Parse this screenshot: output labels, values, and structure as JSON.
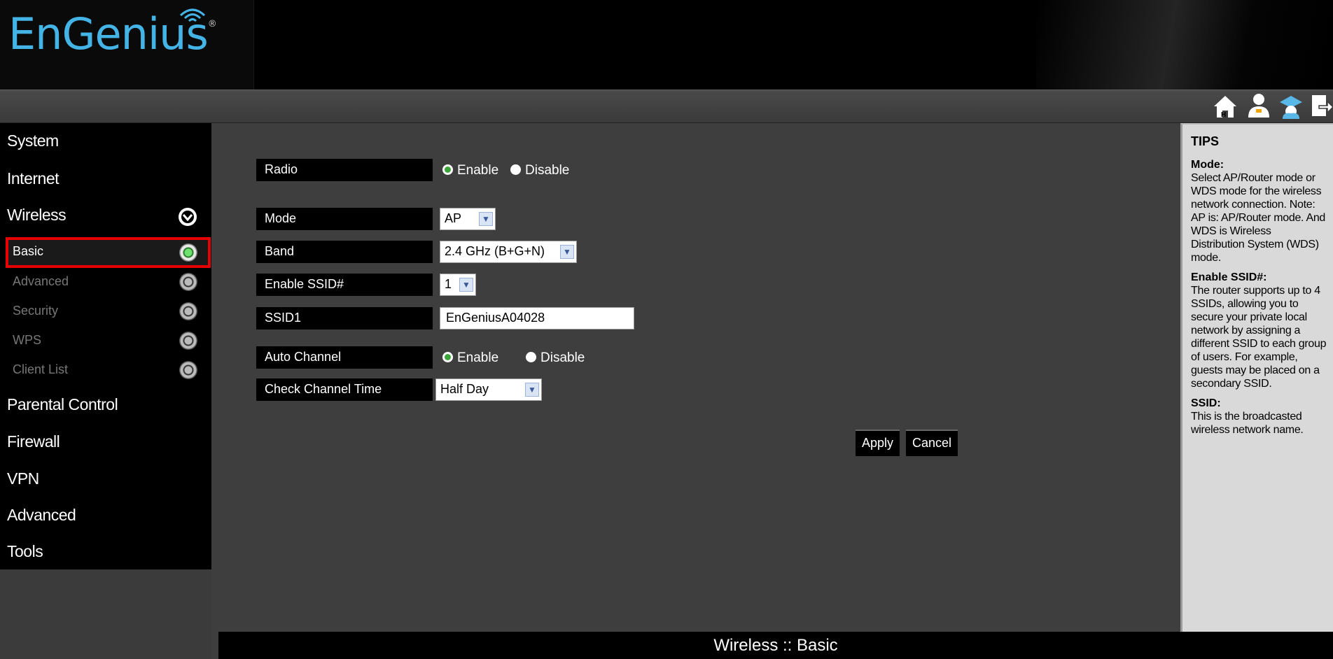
{
  "header": {
    "logo_text": "EnGenius",
    "logo_reg": "®"
  },
  "toolbar": {
    "icons": [
      "home-icon",
      "user-icon",
      "wizard-icon",
      "logout-icon"
    ]
  },
  "sidebar": {
    "items": {
      "system": "System",
      "internet": "Internet",
      "wireless": "Wireless",
      "parental": "Parental Control",
      "firewall": "Firewall",
      "vpn": "VPN",
      "advanced": "Advanced",
      "tools": "Tools"
    },
    "wireless_sub": {
      "basic": "Basic",
      "advanced": "Advanced",
      "security": "Security",
      "wps": "WPS",
      "client_list": "Client List"
    }
  },
  "form": {
    "radio_label": "Radio",
    "radio_enable": "Enable",
    "radio_disable": "Disable",
    "mode_label": "Mode",
    "mode_value": "AP",
    "band_label": "Band",
    "band_value": "2.4 GHz (B+G+N)",
    "enable_ssid_label": "Enable SSID#",
    "enable_ssid_value": "1",
    "ssid1_label": "SSID1",
    "ssid1_value": "EnGeniusA04028",
    "auto_channel_label": "Auto Channel",
    "auto_enable": "Enable",
    "auto_disable": "Disable",
    "check_time_label": "Check Channel Time",
    "check_time_value": "Half Day",
    "apply": "Apply",
    "cancel": "Cancel"
  },
  "tips": {
    "heading": "TIPS",
    "mode_title": "Mode:",
    "mode_body": "Select AP/Router mode or WDS mode for the wireless network connection. Note: AP is: AP/Router mode. And WDS is Wireless Distribution System (WDS) mode.",
    "ssid_num_title": "Enable SSID#:",
    "ssid_num_body": "The router supports up to 4 SSIDs, allowing you to secure your private local network by assigning a different SSID to each group of users. For example, guests may be placed on a secondary SSID.",
    "ssid_title": "SSID:",
    "ssid_body": "This is the broadcasted wireless network name."
  },
  "footer": {
    "title": "Wireless :: Basic"
  },
  "colors": {
    "accent": "#44b3e6",
    "highlight": "#e60000",
    "active_dot": "#6ee26e"
  }
}
